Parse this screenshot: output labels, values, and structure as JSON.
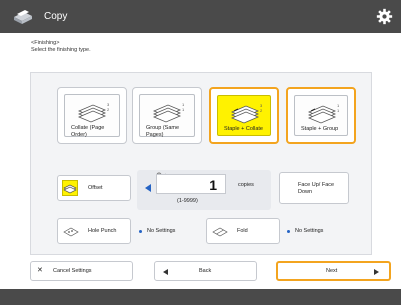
{
  "app": {
    "title": "Copy",
    "app_icon": "copy-icon",
    "settings_icon": "gear-icon"
  },
  "breadcrumb": {
    "line1": "<Finishing>",
    "line2": "Select the finishing type."
  },
  "finishing": {
    "options": [
      {
        "label": "Collate (Page Order)",
        "selected": false
      },
      {
        "label": "Group (Same Pages)",
        "selected": false
      },
      {
        "label": "Staple + Collate",
        "selected": true
      },
      {
        "label": "Staple + Group",
        "selected": true
      }
    ]
  },
  "offset": {
    "label": "Offset"
  },
  "copies": {
    "value": "1",
    "unit": "copies",
    "range": "(1-9999)"
  },
  "face": {
    "label": "Face Up/ Face Down"
  },
  "hole_punch": {
    "label": "Hole Punch",
    "status": "No Settings"
  },
  "fold": {
    "label": "Fold",
    "status": "No Settings"
  },
  "nav": {
    "cancel": "Cancel Settings",
    "back": "Back",
    "next": "Next"
  },
  "colors": {
    "accent": "#f3a41f",
    "highlight": "#fff200",
    "topbar": "#4a4a4a",
    "marker": "#2563c4"
  }
}
